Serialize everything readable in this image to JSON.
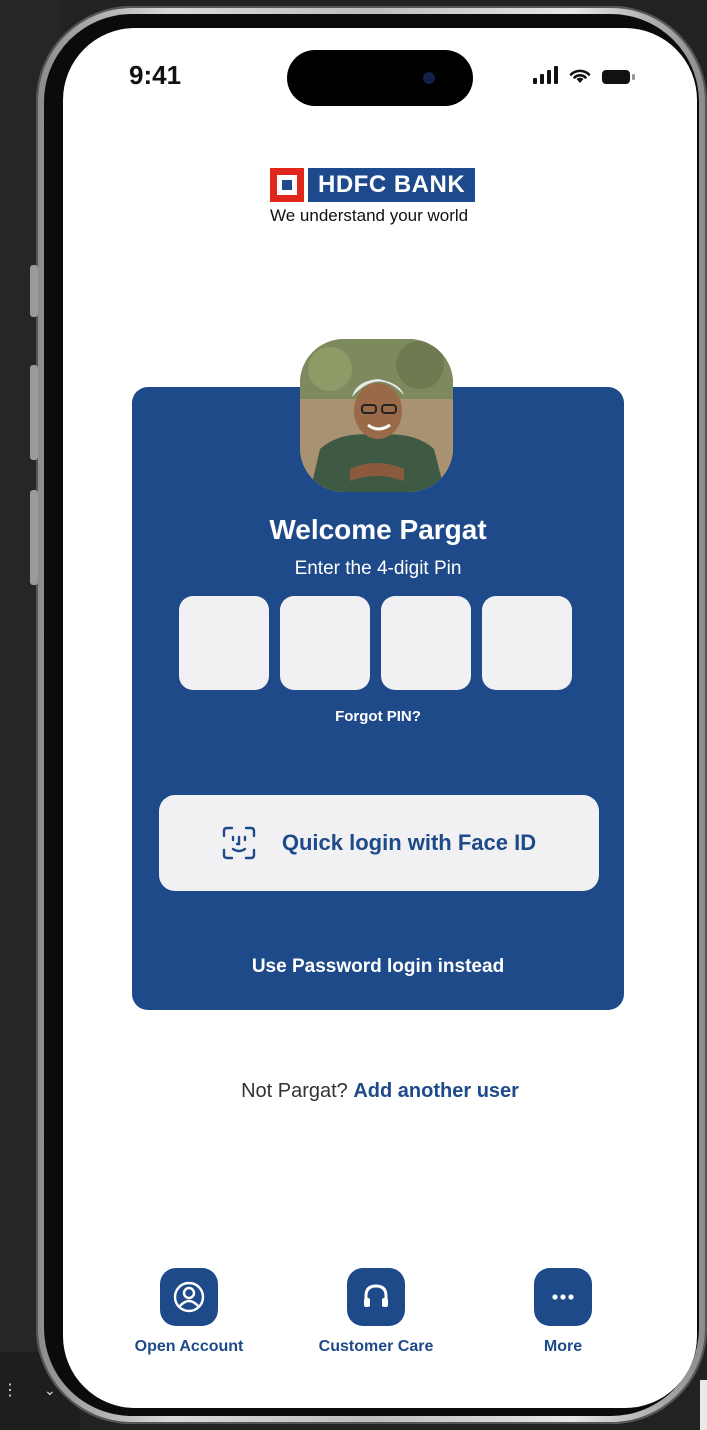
{
  "status_bar": {
    "time": "9:41"
  },
  "logo": {
    "brand": "HDFC BANK",
    "tagline": "We understand your world"
  },
  "login_card": {
    "welcome": "Welcome Pargat",
    "pin_prompt": "Enter the 4-digit Pin",
    "pin_digits": [
      "",
      "",
      "",
      ""
    ],
    "forgot_pin": "Forgot PIN?",
    "face_id_button": "Quick login with Face ID",
    "password_login": "Use Password login instead"
  },
  "switch_user": {
    "prefix": "Not Pargat?",
    "link": "Add another user"
  },
  "bottom_actions": [
    {
      "label": "Open Account",
      "icon": "person-circle-icon"
    },
    {
      "label": "Customer Care",
      "icon": "headset-icon"
    },
    {
      "label": "More",
      "icon": "more-dots-icon"
    }
  ],
  "colors": {
    "primary": "#1e4a8a",
    "logo_red": "#e1261c",
    "pin_box": "#f1f1f3"
  }
}
